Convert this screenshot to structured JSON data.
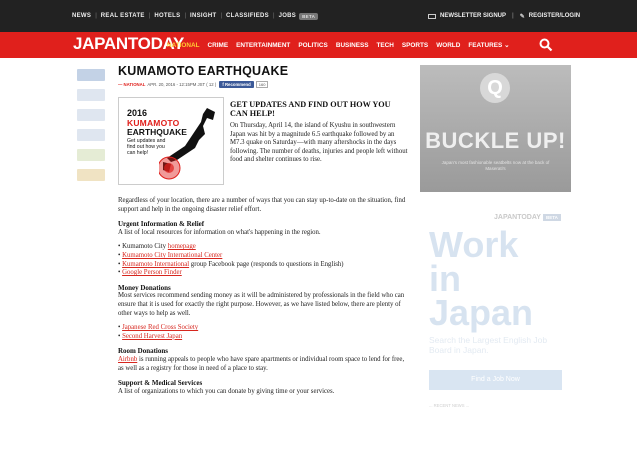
{
  "topbar": {
    "items": [
      "NEWS",
      "REAL ESTATE",
      "HOTELS",
      "INSIGHT",
      "CLASSIFIEDS",
      "JOBS"
    ],
    "jobs_badge": "BETA",
    "newsletter": "NEWSLETTER SIGNUP",
    "register": "REGISTER/LOGIN"
  },
  "navbar": {
    "logo": "JAPANTODAY",
    "items": [
      "NATIONAL",
      "CRIME",
      "ENTERTAINMENT",
      "POLITICS",
      "BUSINESS",
      "TECH",
      "SPORTS",
      "WORLD",
      "FEATURES ⌄"
    ]
  },
  "article": {
    "title": "KUMAMOTO EARTHQUAKE",
    "meta": {
      "category": "— NATIONAL",
      "date": "APR. 20, 2016 - 12:15PM JST ( 12 )",
      "recommend": "Recommend",
      "count": "160"
    },
    "promo": {
      "year": "2016",
      "line1": "KUMAMOTO",
      "line2": "EARTHQUAKE",
      "sub": "Get updates and find out how you can help!"
    },
    "heading": "GET UPDATES AND FIND OUT HOW YOU CAN HELP!",
    "intro": "On Thursday, April 14, the island of Kyushu in southwestern Japan was hit by a magnitude 6.5 earthquake followed by an M7.3 quake on Saturday—with many aftershocks in the days following. The number of deaths, injuries and people left without food and shelter continues to rise.",
    "para1": "Regardless of your location, there are a number of ways that you can stay up-to-date on the situation, find support and help in the ongoing disaster relief effort.",
    "s1_title": "Urgent Information & Relief",
    "s1_text": "A list of local resources for information on what's happening in the region.",
    "s1_li1_pre": "Kumamoto City ",
    "s1_li1_link": "homepage",
    "s1_li2_link": "Kumamoto City International Center",
    "s1_li3_link": "Kumamoto International",
    "s1_li3_post": " group Facebook page (responds to questions in English)",
    "s1_li4_link": "Google Person Finder",
    "s2_title": "Money Donations",
    "s2_text": "Most services recommend sending money as it will be administered by professionals in the field who can ensure that it is used for exactly the right purpose. However, as we have listed below, there are plenty of other ways to help as well.",
    "s2_li1_link": "Japanese Red Cross Society",
    "s2_li2_link": "Second Harvest Japan",
    "s3_title": "Room Donations",
    "s3_link": "Airbnb",
    "s3_text": " is running appeals to people who have spare apartments or individual room space to lend for free, as well as a registry for those in need of a place to stay.",
    "s4_title": "Support & Medical Services",
    "s4_text": "A list of organizations to which you can donate by giving time or your services."
  },
  "sidebar": {
    "ad1": {
      "title": "BUCKLE UP!",
      "text": "Japan's most fashionable seatbelts now at the back of Maserati's"
    },
    "ad2": {
      "brand": "JAPANTODAY",
      "badge": "BETA",
      "headline": "Work in Japan",
      "sub": "Search the Largest English Job Board in Japan.",
      "button": "Find a Job Now",
      "news": "... RECENT NEWS ..."
    }
  }
}
